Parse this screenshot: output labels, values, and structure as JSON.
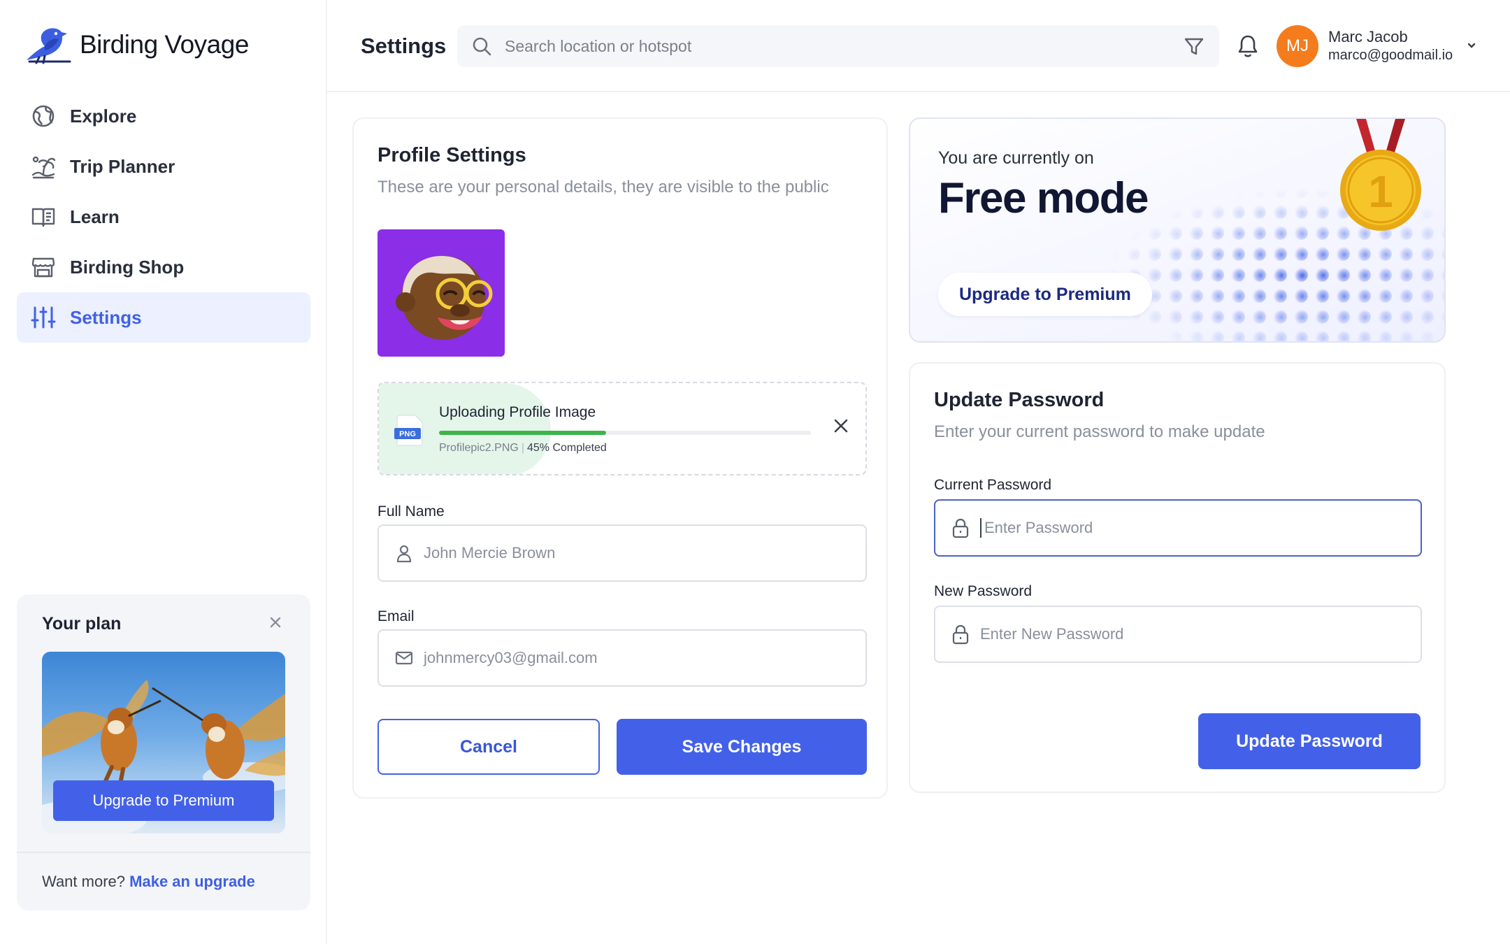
{
  "app": {
    "name": "Birding Voyage"
  },
  "sidebar": {
    "items": [
      {
        "label": "Explore",
        "icon": "globe-icon"
      },
      {
        "label": "Trip Planner",
        "icon": "island-icon"
      },
      {
        "label": "Learn",
        "icon": "book-icon"
      },
      {
        "label": "Birding Shop",
        "icon": "store-icon"
      },
      {
        "label": "Settings",
        "icon": "sliders-icon",
        "active": true
      }
    ],
    "plan": {
      "title": "Your plan",
      "upgrade_label": "Upgrade to  Premium",
      "more_text": "Want more?",
      "more_link": "Make an upgrade"
    }
  },
  "header": {
    "title": "Settings",
    "search_placeholder": "Search location or hotspot",
    "user": {
      "initials": "MJ",
      "name": "Marc Jacob",
      "email": "marco@goodmail.io"
    }
  },
  "profile": {
    "title": "Profile Settings",
    "subtitle": "These are your personal details, they are visible to the public",
    "upload": {
      "badge": "PNG",
      "title": "Uploading Profile Image",
      "filename": "Profilepic2.PNG",
      "separator": "|",
      "progress_text": "45% Completed",
      "progress": 0.45
    },
    "full_name": {
      "label": "Full Name",
      "placeholder": "John Mercie Brown"
    },
    "email": {
      "label": "Email",
      "placeholder": "johnmercy03@gmail.com"
    },
    "cancel_label": "Cancel",
    "save_label": "Save Changes"
  },
  "plan_banner": {
    "subtitle": "You are currently on",
    "title": "Free mode",
    "button_label": "Upgrade to Premium",
    "medal_number": "1"
  },
  "password": {
    "title": "Update Password",
    "subtitle": "Enter your current password to make update",
    "current": {
      "label": "Current Password",
      "placeholder": "Enter Password"
    },
    "new": {
      "label": "New Password",
      "placeholder": "Enter New Password"
    },
    "button_label": "Update Password"
  },
  "colors": {
    "accent": "#4361e8",
    "active_bg": "#ecf0ff",
    "avatar": "#f47c1d",
    "progress": "#3bb54a",
    "profile_bg": "#8b2ee8"
  }
}
